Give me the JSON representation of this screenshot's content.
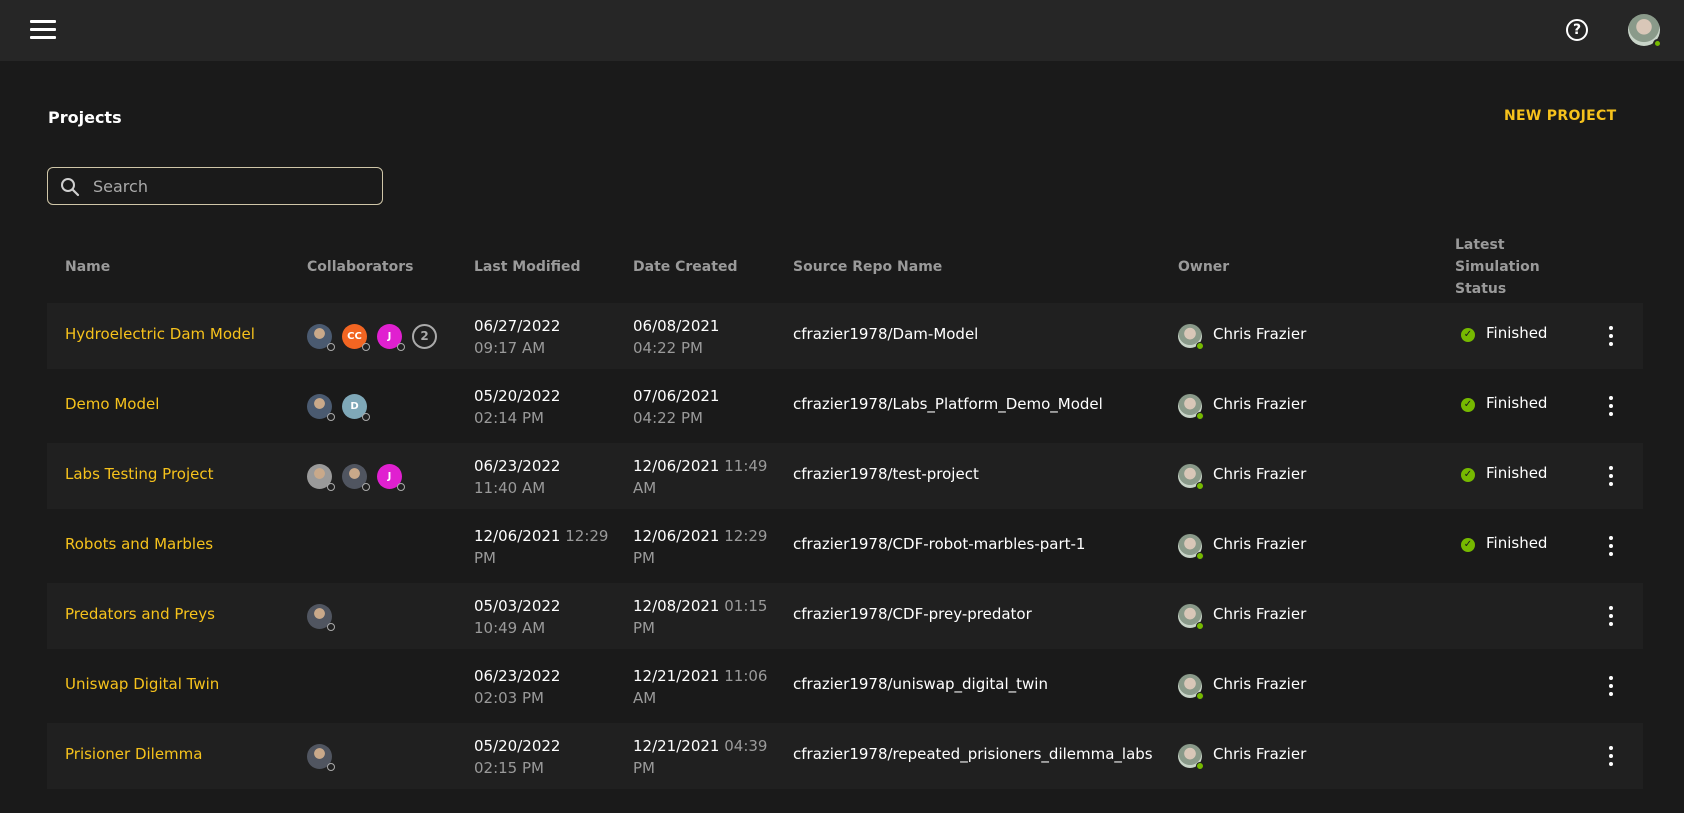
{
  "header": {
    "menu_icon": "hamburger-menu-icon",
    "help_icon": "help-circle-icon",
    "help_glyph": "?"
  },
  "page": {
    "title": "Projects",
    "new_project_label": "NEW PROJECT"
  },
  "search": {
    "placeholder": "Search",
    "value": ""
  },
  "columns": {
    "name": "Name",
    "collaborators": "Collaborators",
    "last_modified": "Last Modified",
    "date_created": "Date Created",
    "source_repo": "Source Repo Name",
    "owner": "Owner",
    "status_line1": "Latest",
    "status_line2": "Simulation",
    "status_line3": "Status"
  },
  "colors": {
    "accent": "#f6c21c",
    "success": "#76b900",
    "background": "#1a1a1a",
    "row_alt": "#202020"
  },
  "rows": [
    {
      "name": "Hydroelectric Dam Model",
      "collaborators": [
        {
          "type": "photo",
          "color": "#4a5a70"
        },
        {
          "type": "initials",
          "text": "CC",
          "color": "#f26522"
        },
        {
          "type": "initials",
          "text": "J",
          "color": "#e020d0"
        },
        {
          "type": "count",
          "text": "2"
        }
      ],
      "modified_line1": "06/27/2022",
      "modified_line1_extra": "",
      "modified_line2": "09:17 AM",
      "created_line1": "06/08/2021",
      "created_line1_extra": "",
      "created_line2": "04:22 PM",
      "repo": "cfrazier1978/Dam-Model",
      "owner": "Chris Frazier",
      "status": "Finished"
    },
    {
      "name": "Demo Model",
      "collaborators": [
        {
          "type": "photo",
          "color": "#4a5a70"
        },
        {
          "type": "initials",
          "text": "D",
          "color": "#7fa8b8"
        }
      ],
      "modified_line1": "05/20/2022",
      "modified_line1_extra": "",
      "modified_line2": "02:14 PM",
      "created_line1": "07/06/2021",
      "created_line1_extra": "",
      "created_line2": "04:22 PM",
      "repo": "cfrazier1978/Labs_Platform_Demo_Model",
      "owner": "Chris Frazier",
      "status": "Finished"
    },
    {
      "name": "Labs Testing Project",
      "collaborators": [
        {
          "type": "photo",
          "color": "#9a9a9a"
        },
        {
          "type": "photo",
          "color": "#505560"
        },
        {
          "type": "initials",
          "text": "J",
          "color": "#e020d0"
        }
      ],
      "modified_line1": "06/23/2022",
      "modified_line1_extra": "",
      "modified_line2": "11:40 AM",
      "created_line1": "12/06/2021",
      "created_line1_extra": "11:49",
      "created_line2": "AM",
      "repo": "cfrazier1978/test-project",
      "owner": "Chris Frazier",
      "status": "Finished"
    },
    {
      "name": "Robots and Marbles",
      "collaborators": [],
      "modified_line1": "12/06/2021",
      "modified_line1_extra": "12:29",
      "modified_line2": "PM",
      "created_line1": "12/06/2021",
      "created_line1_extra": "12:29",
      "created_line2": "PM",
      "repo": "cfrazier1978/CDF-robot-marbles-part-1",
      "owner": "Chris Frazier",
      "status": "Finished"
    },
    {
      "name": "Predators and Preys",
      "collaborators": [
        {
          "type": "photo",
          "color": "#505560"
        }
      ],
      "modified_line1": "05/03/2022",
      "modified_line1_extra": "",
      "modified_line2": "10:49 AM",
      "created_line1": "12/08/2021",
      "created_line1_extra": "01:15",
      "created_line2": "PM",
      "repo": "cfrazier1978/CDF-prey-predator",
      "owner": "Chris Frazier",
      "status": ""
    },
    {
      "name": "Uniswap Digital Twin",
      "collaborators": [],
      "modified_line1": "06/23/2022",
      "modified_line1_extra": "",
      "modified_line2": "02:03 PM",
      "created_line1": "12/21/2021",
      "created_line1_extra": "11:06",
      "created_line2": "AM",
      "repo": "cfrazier1978/uniswap_digital_twin",
      "owner": "Chris Frazier",
      "status": ""
    },
    {
      "name": "Prisioner Dilemma",
      "collaborators": [
        {
          "type": "photo",
          "color": "#505560"
        }
      ],
      "modified_line1": "05/20/2022",
      "modified_line1_extra": "",
      "modified_line2": "02:15 PM",
      "created_line1": "12/21/2021",
      "created_line1_extra": "04:39",
      "created_line2": "PM",
      "repo": "cfrazier1978/repeated_prisioners_dilemma_labs",
      "owner": "Chris Frazier",
      "status": ""
    }
  ]
}
